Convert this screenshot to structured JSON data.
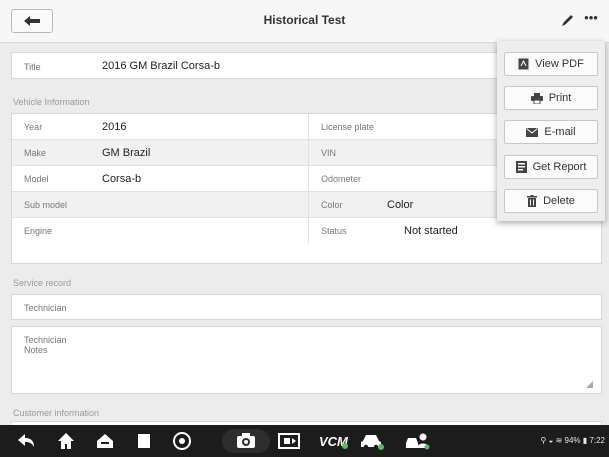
{
  "header": {
    "title": "Historical Test"
  },
  "title_row": {
    "label": "Title",
    "value": "2016 GM Brazil Corsa-b"
  },
  "vehicle_section": {
    "heading": "Vehicle Information",
    "left": [
      {
        "label": "Year",
        "value": "2016"
      },
      {
        "label": "Make",
        "value": "GM Brazil"
      },
      {
        "label": "Model",
        "value": "Corsa-b"
      },
      {
        "label": "Sub model",
        "value": ""
      },
      {
        "label": "Engine",
        "value": ""
      }
    ],
    "right": [
      {
        "label": "License plate",
        "value": ""
      },
      {
        "label": "VIN",
        "value": ""
      },
      {
        "label": "Odometer",
        "value": ""
      },
      {
        "label": "Color",
        "value": "Color"
      },
      {
        "label": "Status",
        "value": "Not started"
      }
    ]
  },
  "service_section": {
    "heading": "Service record",
    "technician_label": "Technician",
    "notes_label": "Technician\nNotes"
  },
  "customer_section": {
    "heading": "Customer information"
  },
  "menu": {
    "view_pdf": "View PDF",
    "print": "Print",
    "email": "E-mail",
    "get_report": "Get Report",
    "delete": "Delete"
  },
  "status_bar": {
    "battery": "94%",
    "time": "7:22"
  },
  "icons": {
    "back": "back-arrow-icon",
    "edit": "pencil-icon",
    "more": "more-dots-icon"
  }
}
